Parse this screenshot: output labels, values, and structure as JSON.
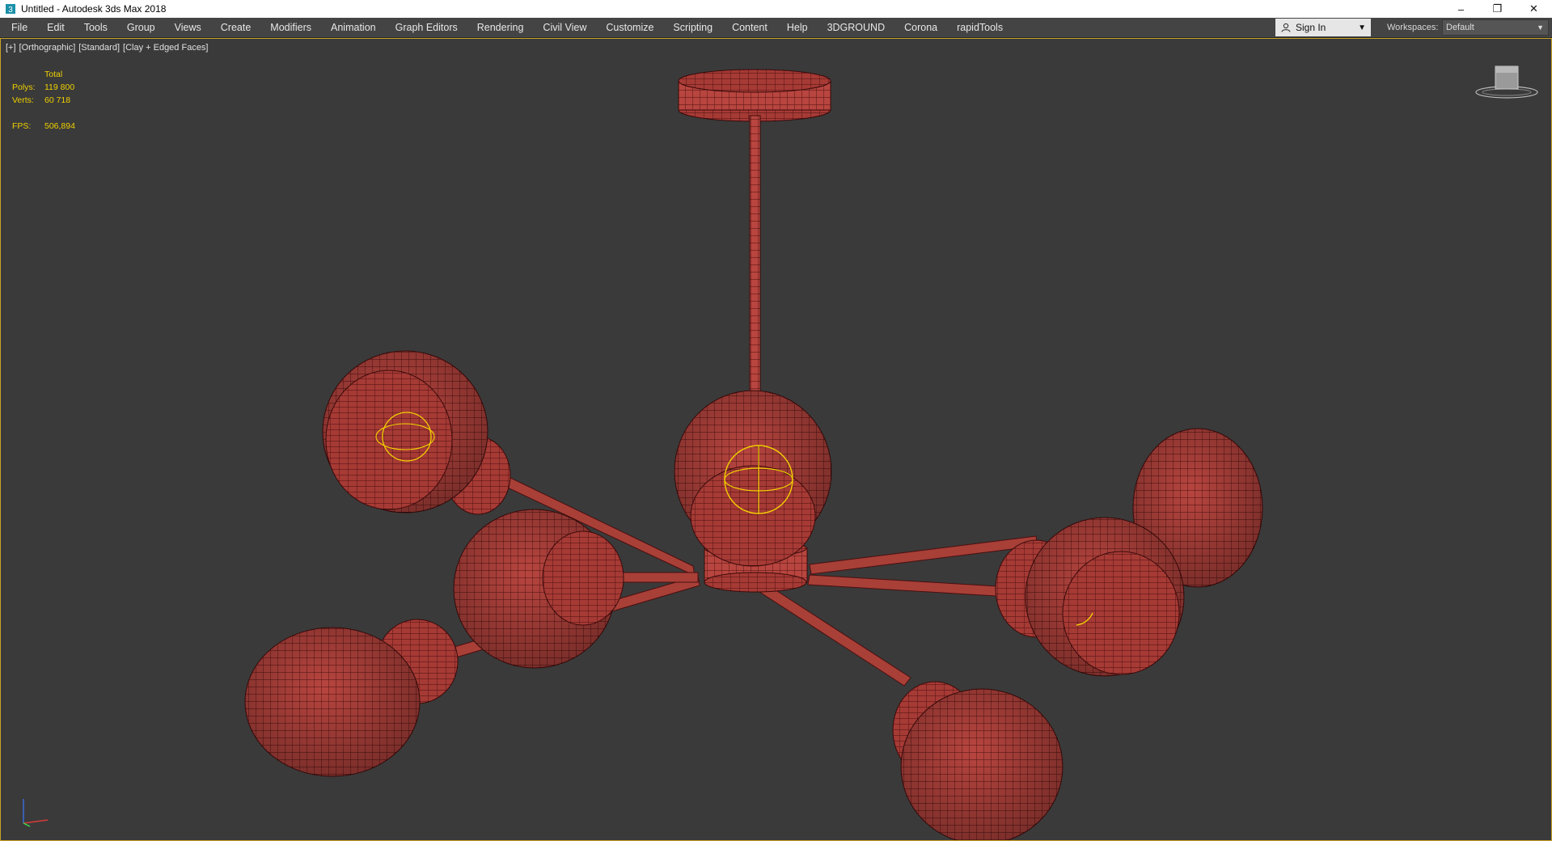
{
  "window": {
    "title": "Untitled - Autodesk 3ds Max 2018",
    "controls": {
      "minimize": "–",
      "restore": "❐",
      "close": "✕"
    }
  },
  "menu": [
    "File",
    "Edit",
    "Tools",
    "Group",
    "Views",
    "Create",
    "Modifiers",
    "Animation",
    "Graph Editors",
    "Rendering",
    "Civil View",
    "Customize",
    "Scripting",
    "Content",
    "Help",
    "3DGROUND",
    "Corona",
    "rapidTools"
  ],
  "account": {
    "sign_in": "Sign In",
    "icon": "user-icon"
  },
  "workspaces": {
    "label": "Workspaces:",
    "value": "Default"
  },
  "viewport": {
    "labels": [
      "[+]",
      "[Orthographic]",
      "[Standard]",
      "[Clay + Edged Faces]"
    ],
    "stats": {
      "header": "Total",
      "polys_label": "Polys:",
      "polys": "119 800",
      "verts_label": "Verts:",
      "verts": "60 718",
      "fps_label": "FPS:",
      "fps": "506,894"
    },
    "viewcube_icon": "viewcube-icon",
    "axis_icon": "axis-tripod-icon"
  },
  "colors": {
    "viewport_bg": "#3a3a3a",
    "mesh_fill": "#b8453f",
    "mesh_wire": "#4a0f0f",
    "selection_gizmo": "#f2d000",
    "viewport_border": "#c9a227"
  }
}
